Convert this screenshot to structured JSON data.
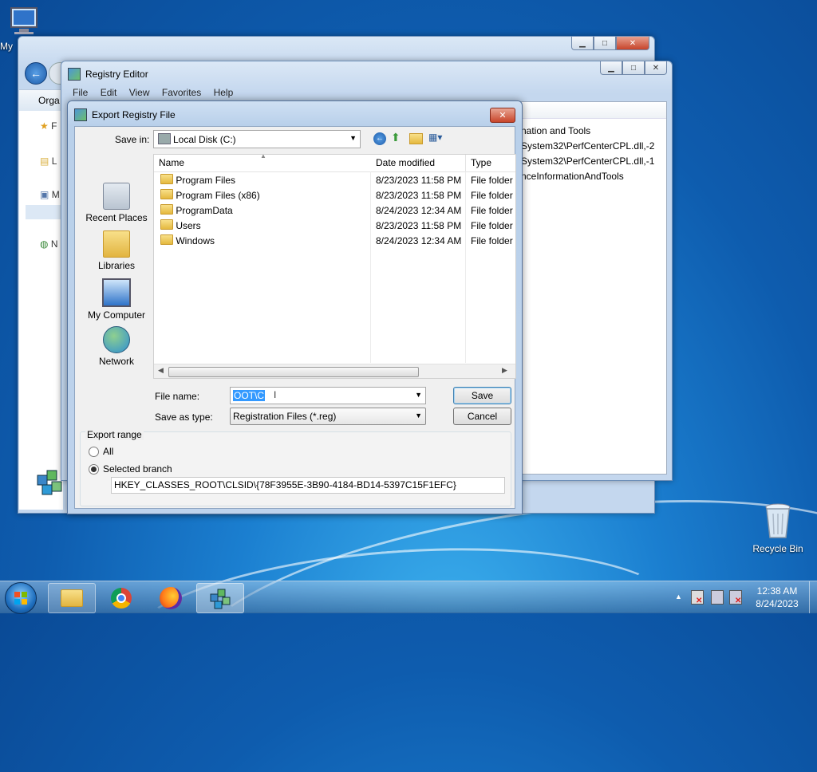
{
  "desktop": {
    "top_left_icon_label": "My",
    "recycle_bin_label": "Recycle Bin"
  },
  "back_window": {
    "toolbar_fragment": "Orga",
    "nav_letters": [
      "F",
      "L",
      "M",
      "N"
    ]
  },
  "regedit": {
    "title": "Registry Editor",
    "menu": [
      "File",
      "Edit",
      "View",
      "Favorites",
      "Help"
    ],
    "right_pane_lines": [
      "nation and Tools",
      "System32\\PerfCenterCPL.dll,-2",
      "System32\\PerfCenterCPL.dll,-1",
      "nceInformationAndTools"
    ]
  },
  "dialog": {
    "title": "Export Registry File",
    "close_glyph": "✕",
    "save_in_label": "Save in:",
    "save_in_value": "Local Disk (C:)",
    "places": [
      "Recent Places",
      "Libraries",
      "My Computer",
      "Network"
    ],
    "columns": [
      "Name",
      "Date modified",
      "Type"
    ],
    "rows": [
      {
        "name": "Program Files",
        "date": "8/23/2023 11:58 PM",
        "type": "File folder"
      },
      {
        "name": "Program Files (x86)",
        "date": "8/23/2023 11:58 PM",
        "type": "File folder"
      },
      {
        "name": "ProgramData",
        "date": "8/24/2023 12:34 AM",
        "type": "File folder"
      },
      {
        "name": "Users",
        "date": "8/23/2023 11:58 PM",
        "type": "File folder"
      },
      {
        "name": "Windows",
        "date": "8/24/2023 12:34 AM",
        "type": "File folder"
      }
    ],
    "file_name_label": "File name:",
    "file_name_value": "OOT\\C",
    "save_as_type_label": "Save as type:",
    "save_as_type_value": "Registration Files (*.reg)",
    "save_button": "Save",
    "cancel_button": "Cancel",
    "export_range_label": "Export range",
    "all_label": "All",
    "selected_branch_label": "Selected branch",
    "selected_branch_checked": true,
    "branch_path": "HKEY_CLASSES_ROOT\\CLSID\\{78F3955E-3B90-4184-BD14-5397C15F1EFC}"
  },
  "taskbar": {
    "clock_time": "12:38 AM",
    "clock_date": "8/24/2023",
    "tray_arrow": "▲"
  }
}
